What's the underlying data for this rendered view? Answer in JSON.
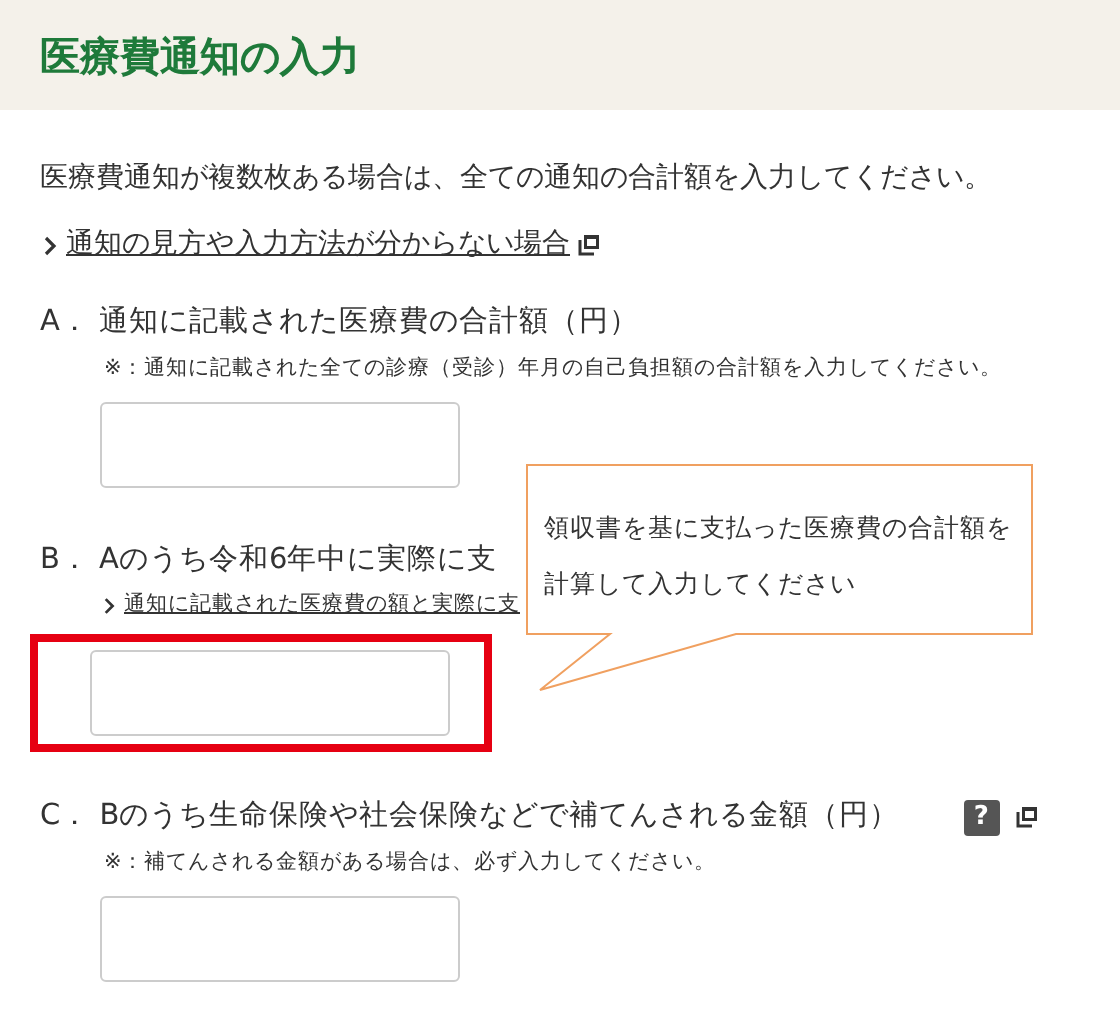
{
  "header": {
    "title": "医療費通知の入力"
  },
  "intro": "医療費通知が複数枚ある場合は、全ての通知の合計額を入力してください。",
  "help_link": {
    "text": "通知の見方や入力方法が分からない場合"
  },
  "questions": [
    {
      "letter": "A．",
      "label": "通知に記載された医療費の合計額（円）",
      "note": "※：通知に記載された全ての診療（受診）年月の自己負担額の合計額を入力してください。",
      "highlighted": false
    },
    {
      "letter": "B．",
      "label": "Aのうち令和6年中に実際に支",
      "link": "通知に記載された医療費の額と実際に支",
      "highlighted": true
    },
    {
      "letter": "C．",
      "label": "Bのうち生命保険や社会保険などで補てんされる金額（円）",
      "help": "?",
      "note": "※：補てんされる金額がある場合は、必ず入力してください。",
      "highlighted": false
    }
  ],
  "callout": {
    "lines": [
      "領収書を基に支払った医療費の合計額を",
      "計算して入力してください"
    ]
  }
}
